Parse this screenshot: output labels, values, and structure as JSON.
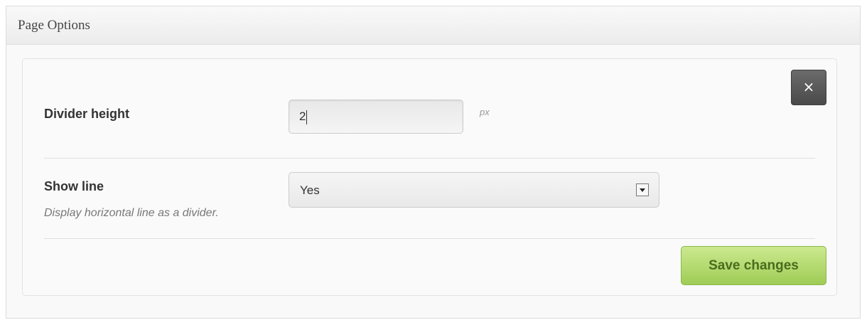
{
  "header": {
    "title": "Page Options"
  },
  "close_button": {
    "symbol": "×",
    "icon": "close-icon"
  },
  "fields": {
    "divider_height": {
      "label": "Divider height",
      "value": "2",
      "unit": "px"
    },
    "show_line": {
      "label": "Show line",
      "description": "Display horizontal line as a divider.",
      "selected": "Yes",
      "icon": "chevron-down-icon"
    }
  },
  "actions": {
    "save_label": "Save changes"
  },
  "colors": {
    "save_button": "#a8d262",
    "close_button": "#555555"
  }
}
